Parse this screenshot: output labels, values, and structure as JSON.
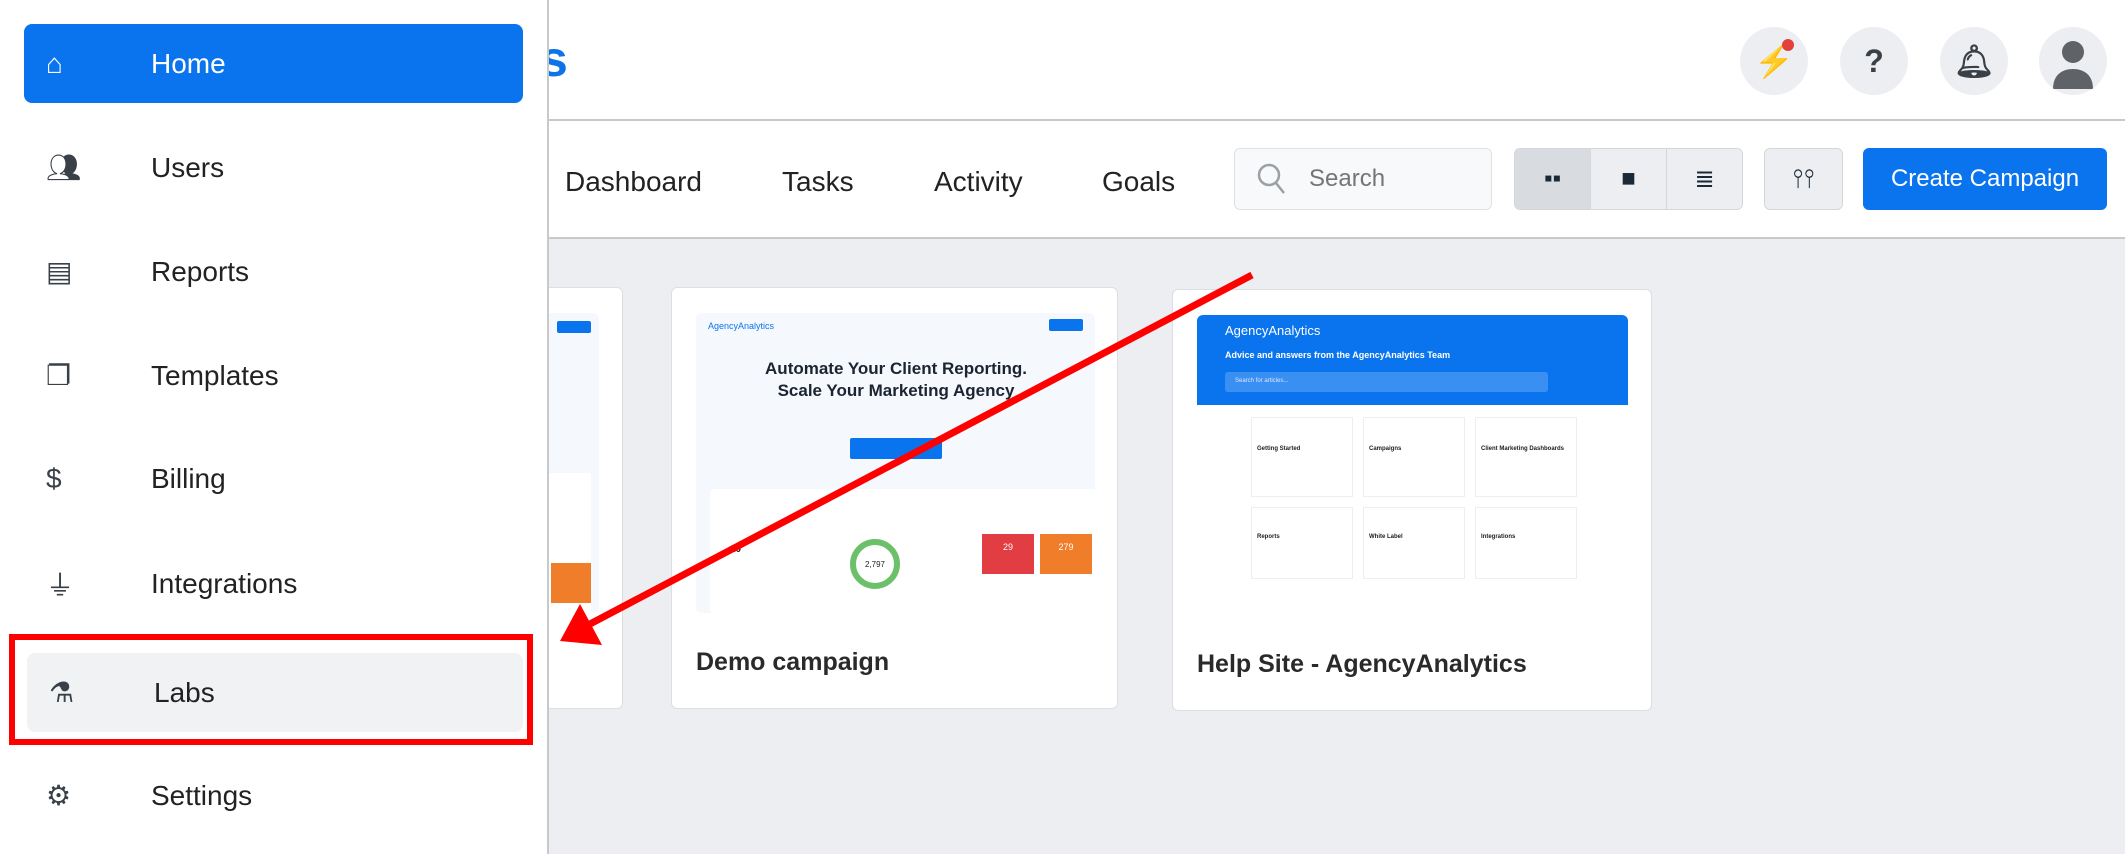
{
  "header": {
    "brand_fragment": "s",
    "icons": [
      "lightning-icon",
      "help-icon",
      "bell-icon",
      "user-avatar-icon"
    ],
    "notification_color": "#e2403b"
  },
  "tabs": [
    "Dashboard",
    "Tasks",
    "Activity",
    "Goals"
  ],
  "search": {
    "placeholder": "Search"
  },
  "view_toggle": [
    "grid-view-icon",
    "folder-view-icon",
    "list-view-icon"
  ],
  "create_button": "Create Campaign",
  "sidebar": {
    "items": [
      {
        "label": "Home",
        "icon": "home-icon",
        "active": true
      },
      {
        "label": "Users",
        "icon": "users-icon"
      },
      {
        "label": "Reports",
        "icon": "report-icon"
      },
      {
        "label": "Templates",
        "icon": "templates-icon"
      },
      {
        "label": "Billing",
        "icon": "dollar-icon"
      },
      {
        "label": "Integrations",
        "icon": "plug-icon"
      },
      {
        "label": "Labs",
        "icon": "flask-icon",
        "highlighted": true
      },
      {
        "label": "Settings",
        "icon": "gear-icon"
      }
    ]
  },
  "cards": [
    {
      "title": "Demo campaign",
      "thumb": {
        "headline": "Automate Your Client Reporting. Scale Your Marketing Agency",
        "logo": "AgencyAnalytics",
        "metric1": "10",
        "metric2": "2,797",
        "metric3": "29",
        "metric4": "279"
      }
    },
    {
      "title": "Help Site - AgencyAnalytics",
      "thumb": {
        "logo": "AgencyAnalytics",
        "headline": "Advice and answers from the AgencyAnalytics Team",
        "search": "Search for articles...",
        "sections": [
          "Getting Started",
          "Campaigns",
          "Client Marketing Dashboards",
          "Reports",
          "White Label",
          "Integrations"
        ]
      }
    }
  ],
  "accent": "#0a74ee",
  "annotation_color": "#ff0000"
}
